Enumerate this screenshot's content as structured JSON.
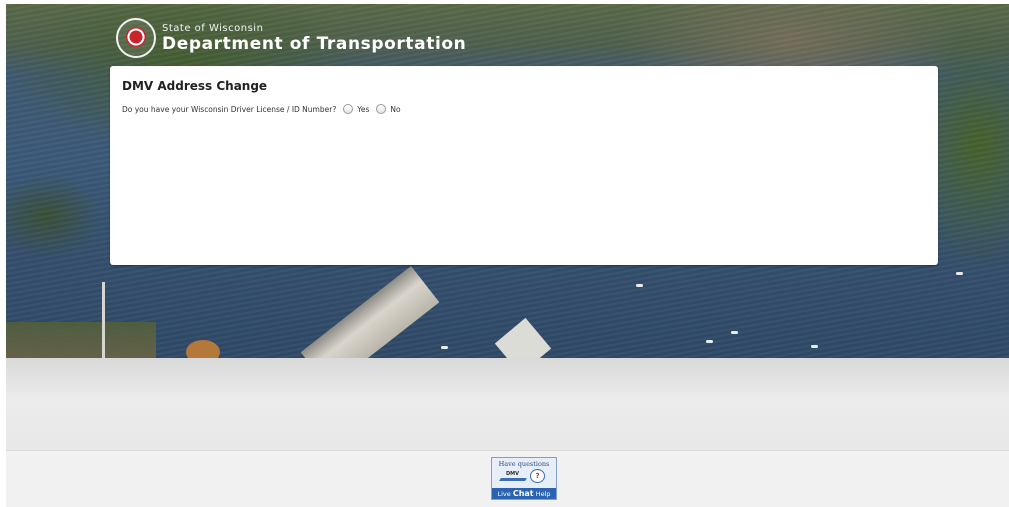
{
  "header": {
    "state_text": "State of Wisconsin",
    "dept_text": "Department of Transportation",
    "seal_icon": "wisdot-seal-icon"
  },
  "form": {
    "title": "DMV Address Change",
    "question": "Do you have your Wisconsin Driver License / ID Number?",
    "options": [
      "Yes",
      "No"
    ],
    "selected": null
  },
  "footer": {
    "chat_widget": {
      "questions_label": "Have questions",
      "dmv_label": "DMV",
      "question_mark": "?",
      "live_label": "Live",
      "chat_label": "Chat",
      "help_label": "Help"
    }
  },
  "colors": {
    "seal_red": "#c9232c",
    "chat_blue": "#2b63b3"
  }
}
